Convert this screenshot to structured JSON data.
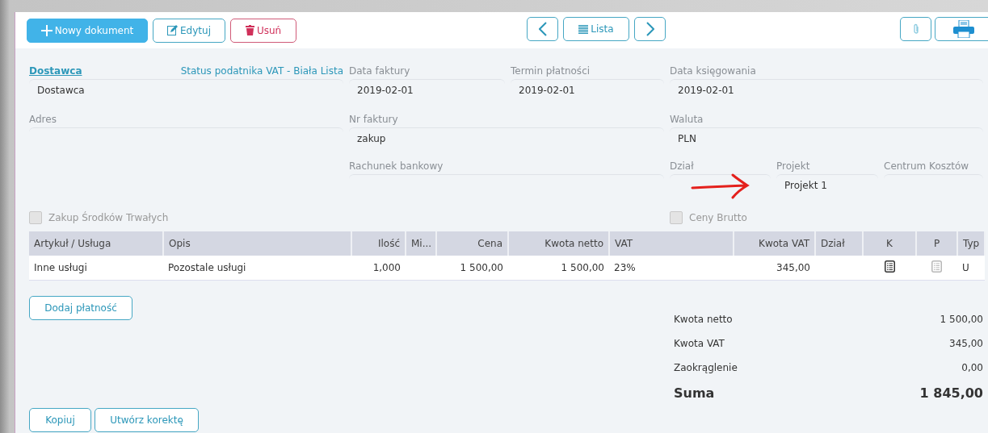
{
  "toolbar": {
    "left_buttons": [
      {
        "label": "Nowy dokument",
        "kind": "primary"
      },
      {
        "label": "Edytuj",
        "kind": "edit"
      },
      {
        "label": "Usuń",
        "kind": "delete"
      }
    ],
    "list_button": "Lista"
  },
  "fields": [
    {
      "label": "Dostawca",
      "kind": "link",
      "link": "Status podatnika VAT - Biała Lista",
      "value": "Dostawca"
    },
    {
      "label": "Data faktury",
      "value": "2019-02-01"
    },
    {
      "label": "Termin płatności",
      "value": "2019-02-01"
    },
    {
      "label": "Data księgowania",
      "value": "2019-02-01"
    },
    {
      "label": "Adres"
    },
    {
      "label": "Nr faktury",
      "value": "zakup"
    },
    {
      "label": "Waluta",
      "value": "PLN"
    },
    {
      "label": "Rachunek bankowy"
    },
    {
      "label": "Dział"
    },
    {
      "label": "Projekt",
      "value": "Projekt 1"
    },
    {
      "label": "Centrum Kosztów"
    }
  ],
  "checkboxes": [
    {
      "label": "Zakup Środków Trwałych",
      "checked": false
    },
    {
      "label": "Ceny Brutto",
      "checked": false
    }
  ],
  "table": {
    "columns": [
      "Artykuł / Usługa",
      "Opis",
      "Ilość",
      "Mi...",
      "Cena",
      "Kwota netto",
      "VAT",
      "Kwota VAT",
      "Dział",
      "K",
      "P",
      "Typ"
    ],
    "rows": [
      {
        "article": "Inne usługi",
        "description": "Pozostale usługi",
        "quantity": "1,000",
        "price": "1 500,00",
        "net": "1 500,00",
        "vat": "23%",
        "vat_amount": "345,00",
        "k": {
          "disabled": false
        },
        "p": {
          "disabled": true
        },
        "type": "U"
      }
    ]
  },
  "payment_button": "Dodaj płatność",
  "summary": [
    {
      "label": "Kwota netto",
      "value": "1 500,00",
      "kind": "normal"
    },
    {
      "label": "Kwota VAT",
      "value": "345,00",
      "kind": "normal"
    },
    {
      "label": "Zaokrąglenie",
      "value": "0,00",
      "kind": "normal"
    },
    {
      "label": "Suma",
      "value": "1 845,00",
      "kind": "total"
    }
  ],
  "bottom_buttons": [
    "Kopiuj",
    "Utwórz korektę"
  ]
}
